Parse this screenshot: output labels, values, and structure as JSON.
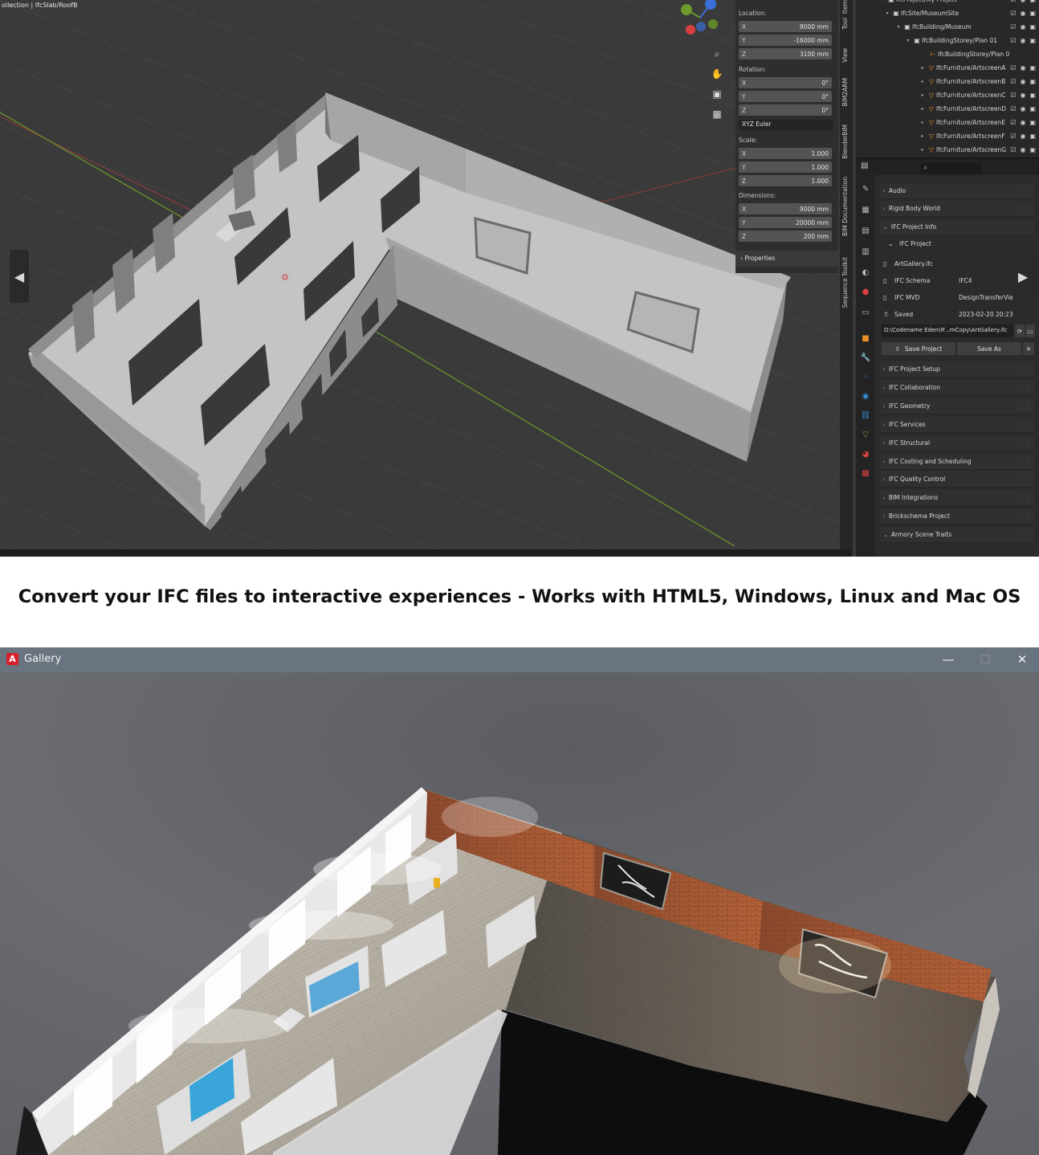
{
  "blender": {
    "collection_path": "ollection | IfcSlab/RoofB",
    "npanel": {
      "location_label": "Location:",
      "location": [
        {
          "axis": "X",
          "value": "8000 mm"
        },
        {
          "axis": "Y",
          "value": "-16000 mm"
        },
        {
          "axis": "Z",
          "value": "3100 mm"
        }
      ],
      "rotation_label": "Rotation:",
      "rotation": [
        {
          "axis": "X",
          "value": "0°"
        },
        {
          "axis": "Y",
          "value": "0°"
        },
        {
          "axis": "Z",
          "value": "0°"
        }
      ],
      "rotation_mode": "XYZ Euler",
      "scale_label": "Scale:",
      "scale": [
        {
          "axis": "X",
          "value": "1.000"
        },
        {
          "axis": "Y",
          "value": "1.000"
        },
        {
          "axis": "Z",
          "value": "1.000"
        }
      ],
      "dimensions_label": "Dimensions:",
      "dimensions": [
        {
          "axis": "X",
          "value": "9000 mm"
        },
        {
          "axis": "Y",
          "value": "20000 mm"
        },
        {
          "axis": "Z",
          "value": "200 mm"
        }
      ],
      "properties_label": "Properties"
    },
    "side_tabs": [
      "Item",
      "Tool",
      "View",
      "BIM2ARM",
      "BlenderBIM",
      "BIM Documentation",
      "Sequence Toolkit"
    ],
    "outliner": [
      {
        "text": "IfcProject/My Project"
      },
      {
        "text": "IfcSite/MuseumSite"
      },
      {
        "text": "IfcBuilding/Museum"
      },
      {
        "text": "IfcBuildingStorey/Plan 01"
      },
      {
        "text": "IfcBuildingStorey/Plan 0"
      },
      {
        "text": "IfcFurniture/ArtscreenA"
      },
      {
        "text": "IfcFurniture/ArtscreenB"
      },
      {
        "text": "IfcFurniture/ArtscreenC"
      },
      {
        "text": "IfcFurniture/ArtscreenD"
      },
      {
        "text": "IfcFurniture/ArtscreenE"
      },
      {
        "text": "IfcFurniture/ArtscreenF"
      },
      {
        "text": "IfcFurniture/ArtscreenG"
      }
    ],
    "properties": {
      "audio": "Audio",
      "rigid_body_world": "Rigid Body World",
      "ifc_project_info": "IFC Project Info",
      "ifc_project": "IFC Project",
      "file_name": "ArtGallery.ifc",
      "schema_label": "IFC Schema",
      "schema_value": "IFC4",
      "mvd_label": "IFC MVD",
      "mvd_value": "DesignTransferView",
      "saved_label": "Saved",
      "saved_value": "2023-02-20 20:23",
      "path": "D:\\Codename Eden\\IF...mCopy\\ArtGallery.ifc",
      "save_project": "Save Project",
      "save_as": "Save As",
      "sections": [
        "IFC Project Setup",
        "IFC Collaboration",
        "IFC Geometry",
        "IFC Services",
        "IFC Structural",
        "IFC Costing and Scheduling",
        "IFC Quality Control",
        "BIM Integrations",
        "Brickschema Project",
        "Armory Scene Traits"
      ]
    }
  },
  "caption": "Convert your IFC files to interactive experiences - Works with HTML5, Windows, Linux and Mac OS",
  "gallery_window": {
    "title": "Gallery",
    "app_icon": "A",
    "minimize": "—",
    "maximize": "☐",
    "close": "✕"
  },
  "colors": {
    "blender_bg": "#3a3a3a",
    "grid_line": "#4a4a4a",
    "x_axis": "#8b3a3a",
    "y_axis": "#6d9a2a",
    "wall": "#a9a9a9",
    "floor": "#c2c2c2",
    "artscreen": "#3b3838",
    "orange_icon": "#e8902a",
    "titlebar": "#6a7380",
    "brick": "#a14e2c"
  },
  "icons": [
    "zoom-icon",
    "hand-icon",
    "camera-icon",
    "grid-icon",
    "lock-icon",
    "eye-icon",
    "camera-small-icon",
    "search-icon",
    "chevron-left-icon",
    "chevron-right-icon",
    "close-icon"
  ]
}
